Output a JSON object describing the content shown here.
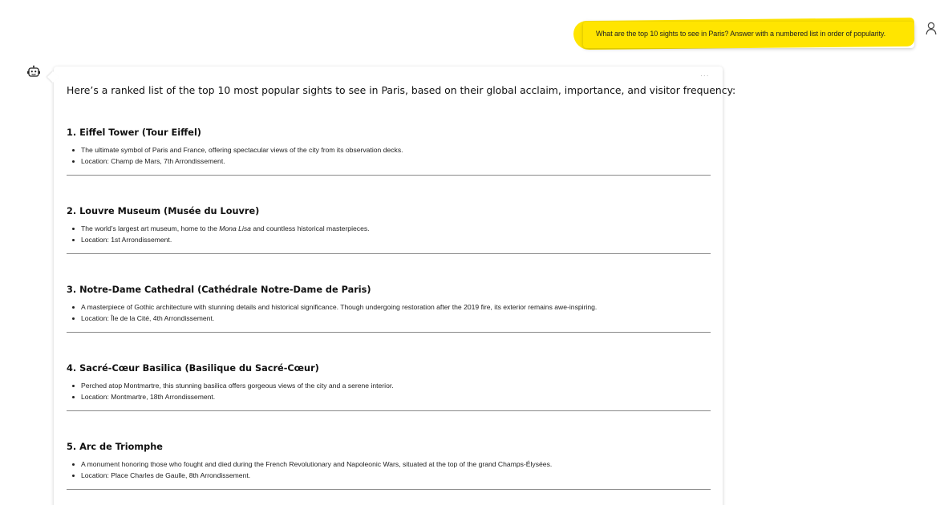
{
  "user_message": {
    "text": "What are the top 10 sights to see in Paris? Answer with a numbered list in order of popularity."
  },
  "icons": {
    "user_avatar": "person-icon",
    "bot_avatar": "robot-icon",
    "more_options": "more-dots-icon"
  },
  "colors": {
    "highlight": "#ffe500"
  },
  "bot_message": {
    "intro": "Here’s a ranked list of the top 10 most popular sights to see in Paris, based on their global acclaim, importance, and visitor frequency:",
    "more_label": "...",
    "sights": [
      {
        "title": "1. Eiffel Tower (Tour Eiffel)",
        "bullet_1": "The ultimate symbol of Paris and France, offering spectacular views of the city from its observation decks.",
        "bullet_2": "Location: Champ de Mars, 7th Arrondissement."
      },
      {
        "title": "2. Louvre Museum (Musée du Louvre)",
        "bullet_1_pre": "The world’s largest art museum, home to the ",
        "bullet_1_em": "Mona Lisa",
        "bullet_1_post": " and countless historical masterpieces.",
        "bullet_2": "Location: 1st Arrondissement."
      },
      {
        "title": "3. Notre-Dame Cathedral (Cathédrale Notre-Dame de Paris)",
        "bullet_1": "A masterpiece of Gothic architecture with stunning details and historical significance. Though undergoing restoration after the 2019 fire, its exterior remains awe-inspiring.",
        "bullet_2": "Location: Île de la Cité, 4th Arrondissement."
      },
      {
        "title": "4. Sacré-Cœur Basilica (Basilique du Sacré-Cœur)",
        "bullet_1": "Perched atop Montmartre, this stunning basilica offers gorgeous views of the city and a serene interior.",
        "bullet_2": "Location: Montmartre, 18th Arrondissement."
      },
      {
        "title": "5. Arc de Triomphe",
        "bullet_1": "A monument honoring those who fought and died during the French Revolutionary and Napoleonic Wars, situated at the top of the grand Champs-Élysées.",
        "bullet_2": "Location: Place Charles de Gaulle, 8th Arrondissement."
      }
    ]
  }
}
